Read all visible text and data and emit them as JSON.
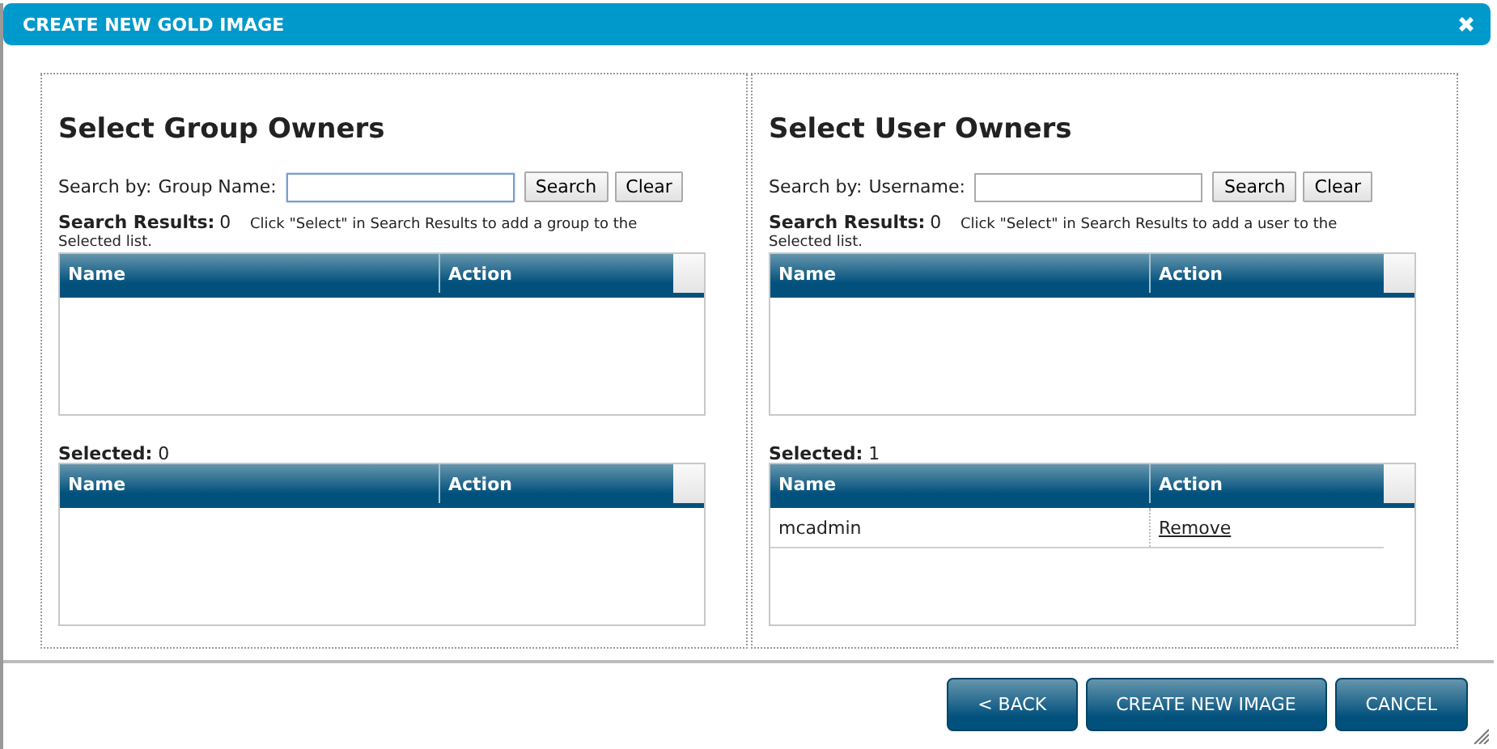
{
  "window": {
    "title": "CREATE NEW GOLD IMAGE"
  },
  "panels": [
    {
      "title": "Select Group Owners",
      "search_label": "Search by:",
      "field_label": "Group Name:",
      "field_focused": true,
      "buttons": [
        "Search",
        "Clear"
      ],
      "results_label": "Search Results:",
      "results_count": "0",
      "hint": "Click \"Select\" in Search Results to add a group to the Selected list.",
      "results_columns": [
        "Name",
        "Action"
      ],
      "selected_label": "Selected:",
      "selected_count": "0",
      "selected_columns": [
        "Name",
        "Action"
      ]
    },
    {
      "title": "Select User Owners",
      "search_label": "Search by:",
      "field_label": "Username:",
      "field_focused": false,
      "buttons": [
        "Search",
        "Clear"
      ],
      "results_label": "Search Results:",
      "results_count": "0",
      "hint": "Click \"Select\" in Search Results to add a user to the Selected list.",
      "results_columns": [
        "Name",
        "Action"
      ],
      "selected_label": "Selected:",
      "selected_count": "1",
      "selected_columns": [
        "Name",
        "Action"
      ],
      "selected_rows": [
        {
          "name": "mcadmin",
          "action": "Remove"
        }
      ]
    }
  ],
  "footer_buttons": [
    "< BACK",
    "CREATE NEW IMAGE",
    "CANCEL"
  ]
}
